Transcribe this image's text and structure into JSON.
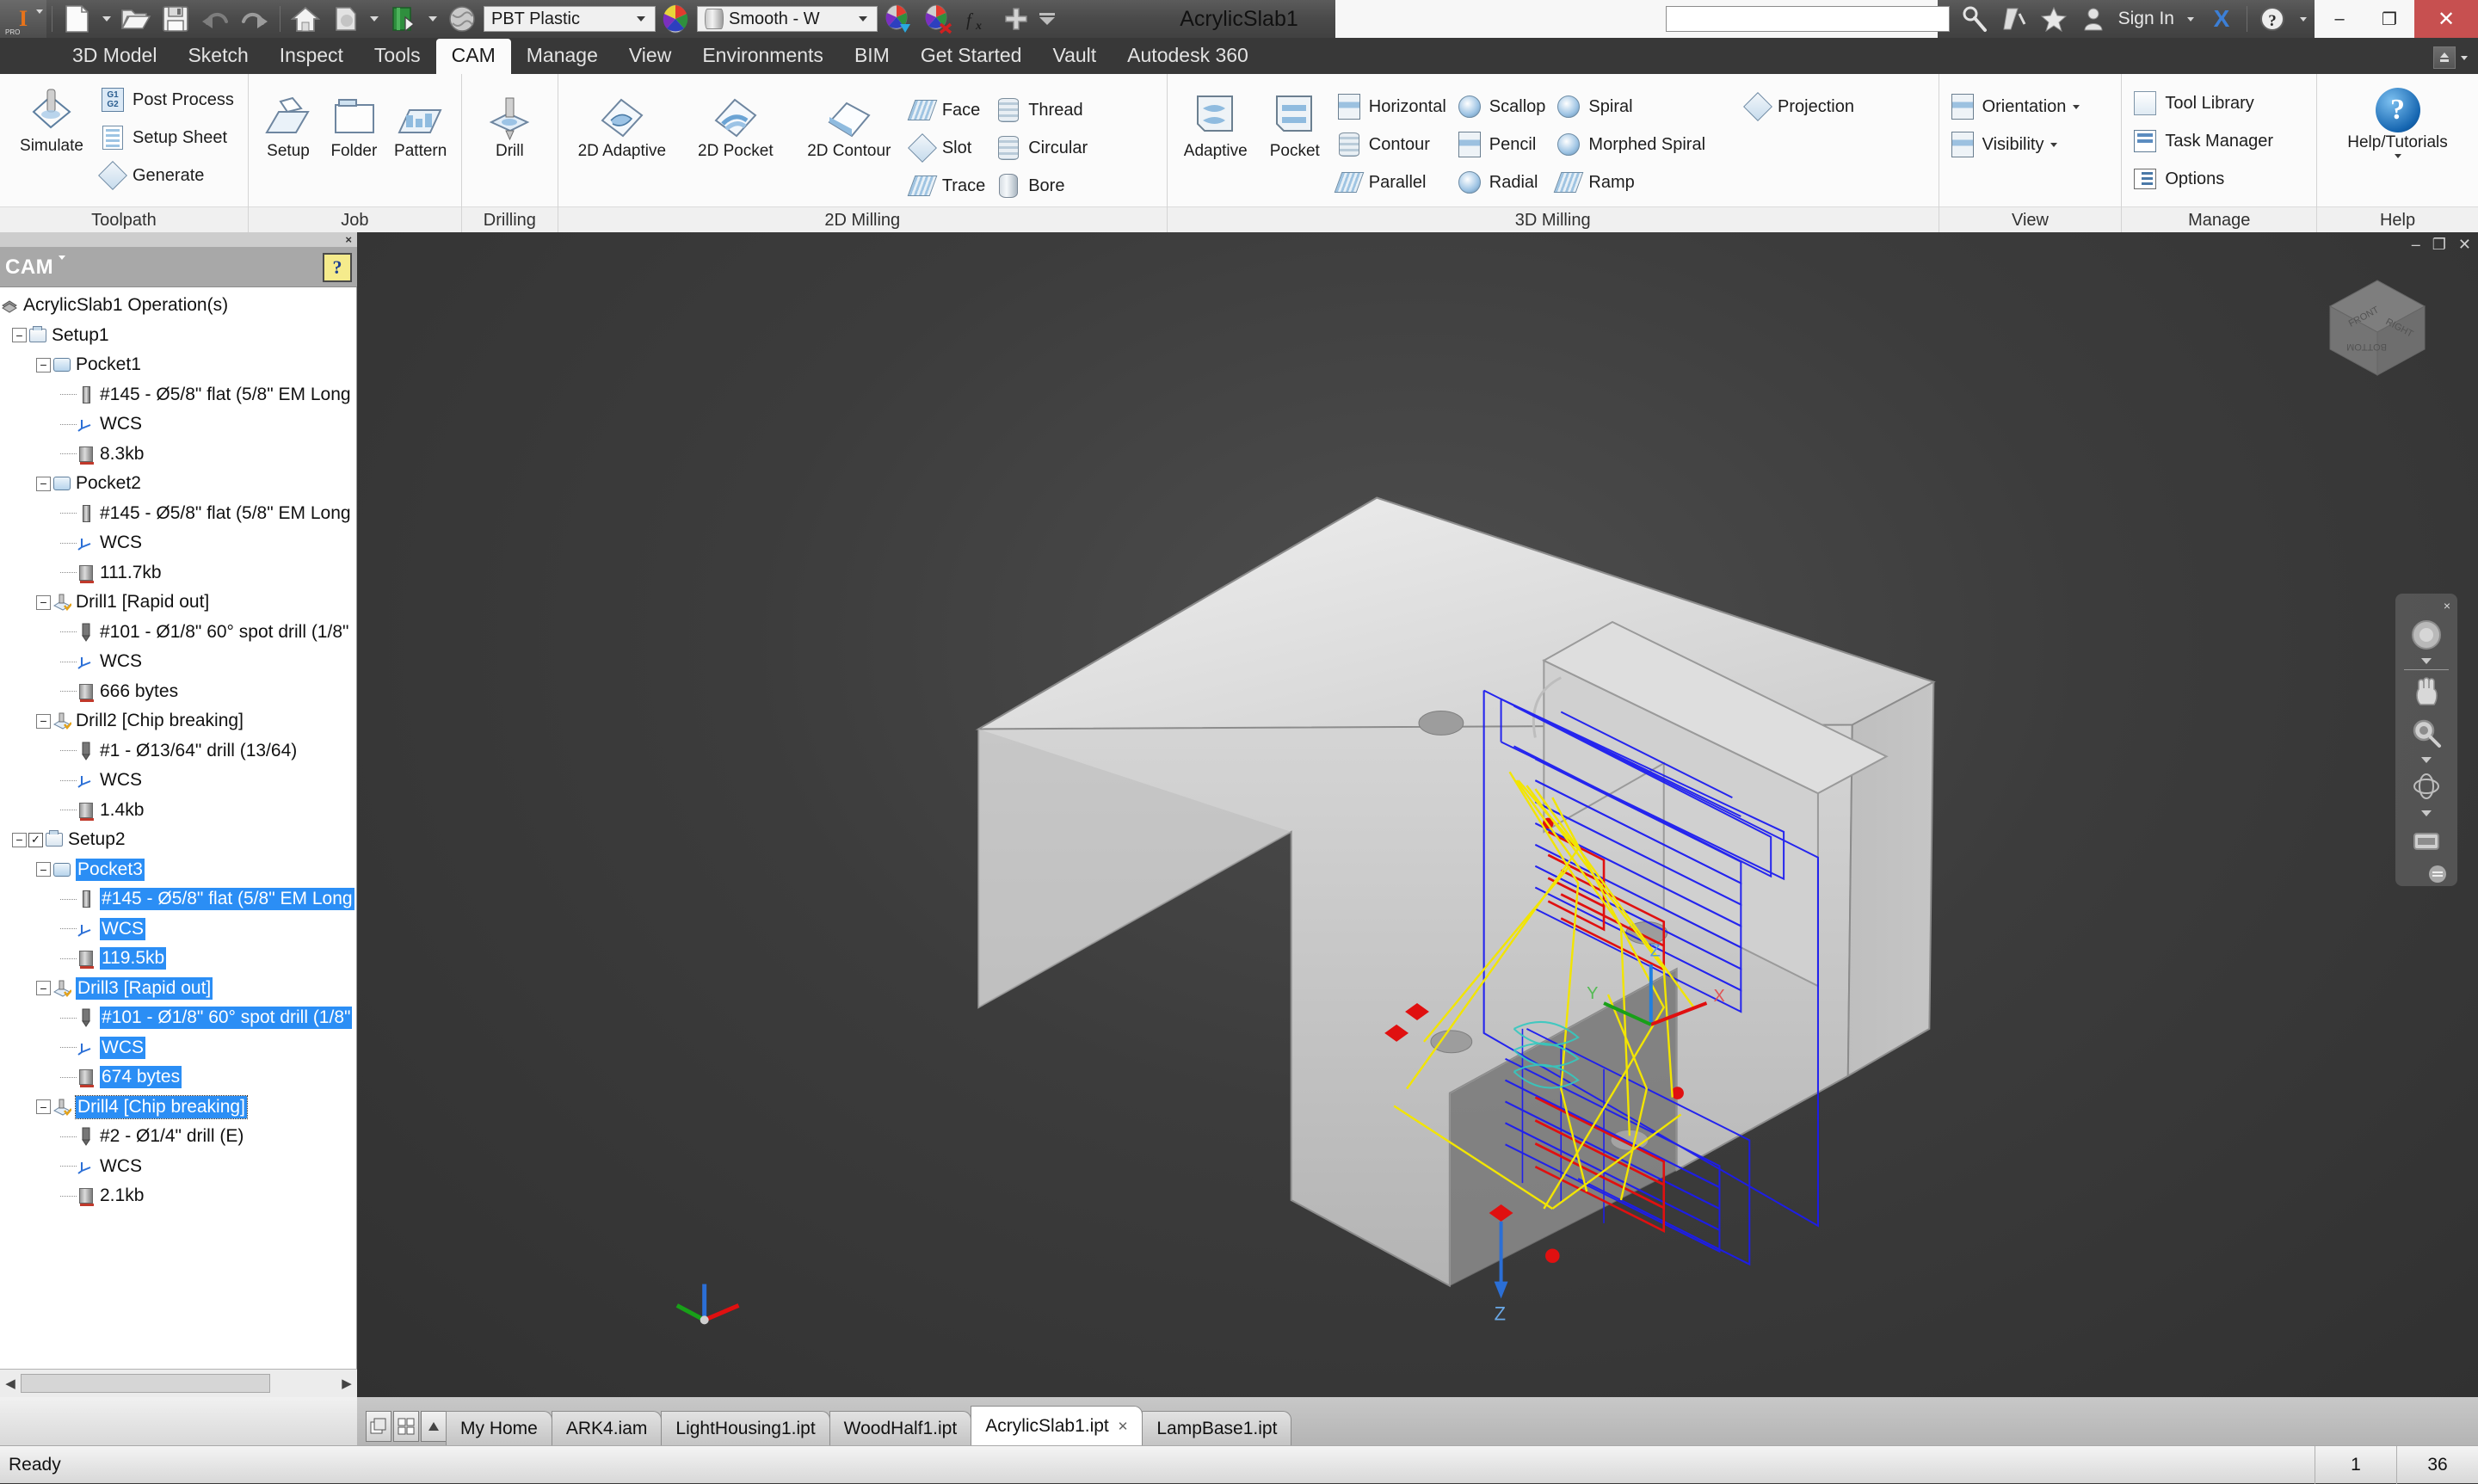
{
  "titlebar": {
    "app_icon": "inventor-pro-icon",
    "quick_access": [
      {
        "name": "new-file-button",
        "icon": "new-document-icon"
      },
      {
        "name": "open-file-button",
        "icon": "open-folder-icon"
      },
      {
        "name": "save-button",
        "icon": "floppy-save-icon"
      },
      {
        "name": "undo-button",
        "icon": "undo-arrow-icon"
      },
      {
        "name": "redo-button",
        "icon": "redo-arrow-icon"
      },
      {
        "name": "home-button",
        "icon": "home-icon"
      },
      {
        "name": "appearance-button",
        "icon": "appearance-icon"
      },
      {
        "name": "material-book-button",
        "icon": "material-library-icon"
      },
      {
        "name": "material-sphere-button",
        "icon": "material-sphere-icon"
      }
    ],
    "material_combo_value": "PBT Plastic",
    "appearance_combo_value": "Smooth - W",
    "tools": [
      {
        "name": "adjust-appearance-button",
        "icon": "color-drop-icon"
      },
      {
        "name": "clear-appearance-button",
        "icon": "color-clear-icon"
      },
      {
        "name": "parameters-button",
        "icon": "fx-icon"
      },
      {
        "name": "add-button",
        "icon": "plus-icon"
      },
      {
        "name": "more-button",
        "icon": "chevron-down-icon"
      }
    ],
    "window_title": "AcrylicSlab1",
    "search_value": "",
    "sign_in_label": "Sign In",
    "exchange_label": "X",
    "help_label": "?",
    "minimize_label": "–",
    "restore_label": "❐",
    "close_label": "✕"
  },
  "ribbon_tabs": [
    {
      "label": "3D Model",
      "active": false
    },
    {
      "label": "Sketch",
      "active": false
    },
    {
      "label": "Inspect",
      "active": false
    },
    {
      "label": "Tools",
      "active": false
    },
    {
      "label": "CAM",
      "active": true
    },
    {
      "label": "Manage",
      "active": false
    },
    {
      "label": "View",
      "active": false
    },
    {
      "label": "Environments",
      "active": false
    },
    {
      "label": "BIM",
      "active": false
    },
    {
      "label": "Get Started",
      "active": false
    },
    {
      "label": "Vault",
      "active": false
    },
    {
      "label": "Autodesk 360",
      "active": false
    }
  ],
  "ribbon_groups": {
    "toolpath": {
      "title": "Toolpath",
      "simulate": "Simulate",
      "post_process": "Post Process",
      "setup_sheet": "Setup Sheet",
      "generate": "Generate"
    },
    "job": {
      "title": "Job",
      "setup": "Setup",
      "folder": "Folder",
      "pattern": "Pattern"
    },
    "drilling": {
      "title": "Drilling",
      "drill": "Drill"
    },
    "milling2d": {
      "title": "2D Milling",
      "adaptive": "2D Adaptive",
      "pocket": "2D Pocket",
      "contour": "2D Contour",
      "face": "Face",
      "slot": "Slot",
      "trace": "Trace",
      "thread": "Thread",
      "circular": "Circular",
      "bore": "Bore"
    },
    "milling3d": {
      "title": "3D Milling",
      "adaptive": "Adaptive",
      "pocket": "Pocket",
      "horizontal": "Horizontal",
      "contour": "Contour",
      "parallel": "Parallel",
      "scallop": "Scallop",
      "pencil": "Pencil",
      "radial": "Radial",
      "spiral": "Spiral",
      "morphed_spiral": "Morphed Spiral",
      "ramp": "Ramp",
      "projection": "Projection"
    },
    "view": {
      "title": "View",
      "orientation": "Orientation",
      "visibility": "Visibility"
    },
    "manage": {
      "title": "Manage",
      "tool_library": "Tool Library",
      "task_manager": "Task Manager",
      "options": "Options"
    },
    "help": {
      "title": "Help",
      "help_tutorials": "Help/Tutorials"
    }
  },
  "browser": {
    "panel_title": "CAM",
    "close_label": "×",
    "help_glyph": "?",
    "tree": [
      {
        "indent": 0,
        "expander": "",
        "checkbox": false,
        "icon": "operations-root-icon",
        "label": "AcrylicSlab1 Operation(s)",
        "selected": false
      },
      {
        "indent": 1,
        "expander": "−",
        "checkbox": false,
        "icon": "setup-icon",
        "label": "Setup1",
        "selected": false
      },
      {
        "indent": 2,
        "expander": "−",
        "checkbox": false,
        "icon": "pocket-operation-icon",
        "label": "Pocket1",
        "selected": false
      },
      {
        "indent": 3,
        "expander": "",
        "checkbox": false,
        "icon": "flat-endmill-tool-icon",
        "label": "#145 - Ø5/8\" flat (5/8\" EM Long",
        "selected": false
      },
      {
        "indent": 3,
        "expander": "",
        "checkbox": false,
        "icon": "wcs-icon",
        "label": "WCS",
        "selected": false
      },
      {
        "indent": 3,
        "expander": "",
        "checkbox": false,
        "icon": "nc-program-icon",
        "label": "8.3kb",
        "selected": false
      },
      {
        "indent": 2,
        "expander": "−",
        "checkbox": false,
        "icon": "pocket-operation-icon",
        "label": "Pocket2",
        "selected": false
      },
      {
        "indent": 3,
        "expander": "",
        "checkbox": false,
        "icon": "flat-endmill-tool-icon",
        "label": "#145 - Ø5/8\" flat (5/8\" EM Long",
        "selected": false
      },
      {
        "indent": 3,
        "expander": "",
        "checkbox": false,
        "icon": "wcs-icon",
        "label": "WCS",
        "selected": false
      },
      {
        "indent": 3,
        "expander": "",
        "checkbox": false,
        "icon": "nc-program-icon",
        "label": "111.7kb",
        "selected": false
      },
      {
        "indent": 2,
        "expander": "−",
        "checkbox": false,
        "icon": "drill-operation-icon",
        "label": "Drill1 [Rapid out]",
        "selected": false
      },
      {
        "indent": 3,
        "expander": "",
        "checkbox": false,
        "icon": "drill-tool-icon",
        "label": "#101 - Ø1/8\" 60° spot drill (1/8\"",
        "selected": false
      },
      {
        "indent": 3,
        "expander": "",
        "checkbox": false,
        "icon": "wcs-icon",
        "label": "WCS",
        "selected": false
      },
      {
        "indent": 3,
        "expander": "",
        "checkbox": false,
        "icon": "nc-program-icon",
        "label": "666 bytes",
        "selected": false
      },
      {
        "indent": 2,
        "expander": "−",
        "checkbox": false,
        "icon": "drill-operation-icon",
        "label": "Drill2 [Chip breaking]",
        "selected": false
      },
      {
        "indent": 3,
        "expander": "",
        "checkbox": false,
        "icon": "drill-tool-icon",
        "label": "#1 - Ø13/64\" drill (13/64)",
        "selected": false
      },
      {
        "indent": 3,
        "expander": "",
        "checkbox": false,
        "icon": "wcs-icon",
        "label": "WCS",
        "selected": false
      },
      {
        "indent": 3,
        "expander": "",
        "checkbox": false,
        "icon": "nc-program-icon",
        "label": "1.4kb",
        "selected": false
      },
      {
        "indent": 1,
        "expander": "−",
        "checkbox": true,
        "icon": "setup-icon",
        "label": "Setup2",
        "selected": false
      },
      {
        "indent": 2,
        "expander": "−",
        "checkbox": false,
        "icon": "pocket-operation-icon",
        "label": "Pocket3",
        "selected": true
      },
      {
        "indent": 3,
        "expander": "",
        "checkbox": false,
        "icon": "flat-endmill-tool-icon",
        "label": "#145 - Ø5/8\" flat (5/8\" EM Long",
        "selected": true
      },
      {
        "indent": 3,
        "expander": "",
        "checkbox": false,
        "icon": "wcs-icon",
        "label": "WCS",
        "selected": true
      },
      {
        "indent": 3,
        "expander": "",
        "checkbox": false,
        "icon": "nc-program-icon",
        "label": "119.5kb",
        "selected": true
      },
      {
        "indent": 2,
        "expander": "−",
        "checkbox": false,
        "icon": "drill-operation-icon",
        "label": "Drill3 [Rapid out]",
        "selected": true
      },
      {
        "indent": 3,
        "expander": "",
        "checkbox": false,
        "icon": "drill-tool-icon",
        "label": "#101 - Ø1/8\" 60° spot drill (1/8\"",
        "selected": true
      },
      {
        "indent": 3,
        "expander": "",
        "checkbox": false,
        "icon": "wcs-icon",
        "label": "WCS",
        "selected": true
      },
      {
        "indent": 3,
        "expander": "",
        "checkbox": false,
        "icon": "nc-program-icon",
        "label": "674 bytes",
        "selected": true
      },
      {
        "indent": 2,
        "expander": "−",
        "checkbox": false,
        "icon": "drill-operation-icon",
        "label": "Drill4 [Chip breaking]",
        "selected": true,
        "focused": true
      },
      {
        "indent": 3,
        "expander": "",
        "checkbox": false,
        "icon": "drill-tool-icon",
        "label": "#2 - Ø1/4\" drill (E)",
        "selected": false
      },
      {
        "indent": 3,
        "expander": "",
        "checkbox": false,
        "icon": "wcs-icon",
        "label": "WCS",
        "selected": false
      },
      {
        "indent": 3,
        "expander": "",
        "checkbox": false,
        "icon": "nc-program-icon",
        "label": "2.1kb",
        "selected": false
      }
    ]
  },
  "viewport": {
    "viewcube": {
      "front": "FRONT",
      "right": "RIGHT",
      "bottom": "BOTTOM"
    },
    "navbar_close": "×",
    "window_minimize": "–",
    "window_restore": "❐",
    "window_close": "✕",
    "axis_labels": {
      "x": "X",
      "y": "Y",
      "z": "Z"
    },
    "colors": {
      "background": "#3c3c3c",
      "model": "#c8c8c8",
      "toolpath_cutting": "#2020ff",
      "toolpath_plunge": "#ff0000",
      "toolpath_rapid": "#ffff00",
      "highlight": "#2b8ef5"
    }
  },
  "document_tabs": [
    {
      "label": "My Home",
      "active": false,
      "closable": false
    },
    {
      "label": "ARK4.iam",
      "active": false,
      "closable": false
    },
    {
      "label": "LightHousing1.ipt",
      "active": false,
      "closable": false
    },
    {
      "label": "WoodHalf1.ipt",
      "active": false,
      "closable": false
    },
    {
      "label": "AcrylicSlab1.ipt",
      "active": true,
      "closable": true,
      "close_glyph": "✕"
    },
    {
      "label": "LampBase1.ipt",
      "active": false,
      "closable": false
    }
  ],
  "statusbar": {
    "message": "Ready",
    "cell1": "1",
    "cell2": "36"
  }
}
